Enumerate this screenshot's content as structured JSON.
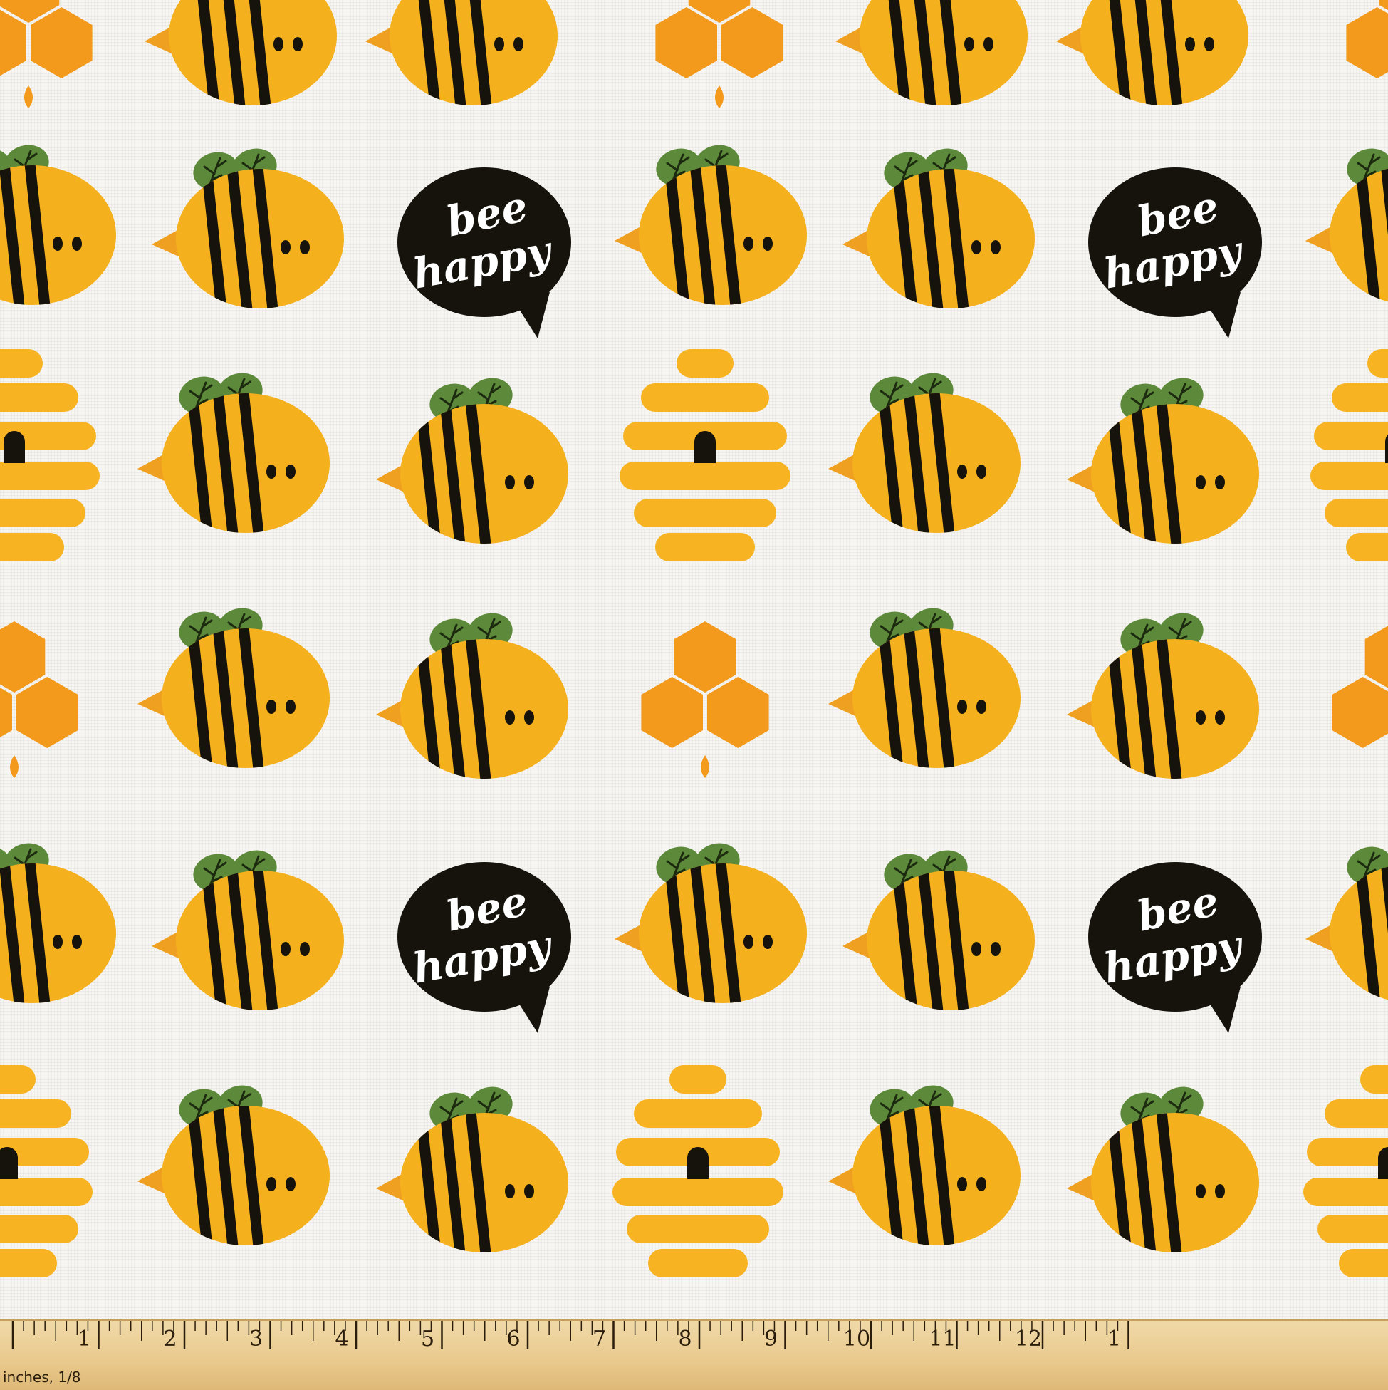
{
  "pattern": {
    "bubble_line1": "bee",
    "bubble_line2": "happy",
    "colors": {
      "bee_body": "#f5b01e",
      "stripe": "#16130c",
      "wing": "#5d8a3a",
      "wing_vein": "#1c2a10",
      "stinger": "#f0a020",
      "honeycomb": "#f39a1c",
      "hive": "#f7b321",
      "bubble": "#16130c",
      "background": "#f6f5f1"
    }
  },
  "ruler": {
    "unit_label": "inches, 1/8",
    "numbers": [
      "1",
      "2",
      "3",
      "4",
      "5",
      "6",
      "7",
      "8",
      "9",
      "10",
      "11",
      "12",
      "1"
    ]
  }
}
